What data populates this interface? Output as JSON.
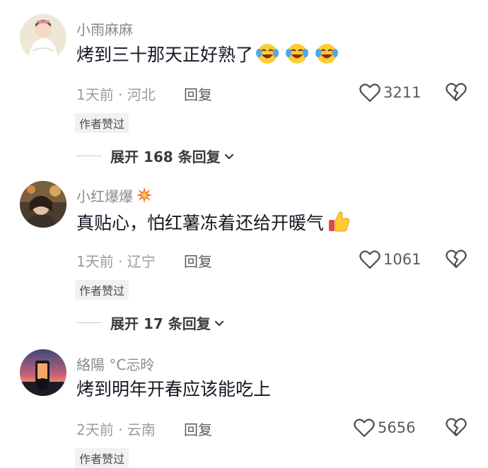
{
  "comments": [
    {
      "username": "小雨麻麻",
      "text": "烤到三十那天正好熟了",
      "text_emoji": [
        "crying-laughing-face",
        "crying-laughing-face",
        "crying-laughing-face"
      ],
      "time_location": "1天前 · 河北",
      "reply_label": "回复",
      "likes": "3211",
      "badge": "作者赞过",
      "expand_label": "展开 168 条回复"
    },
    {
      "username": "小红爆爆",
      "username_emoji": "collision",
      "text": "真贴心，怕红薯冻着还给开暖气",
      "text_emoji": [
        "thumbs-up"
      ],
      "time_location": "1天前 · 辽宁",
      "reply_label": "回复",
      "likes": "1061",
      "badge": "作者赞过",
      "expand_label": "展开 17 条回复"
    },
    {
      "username": "絡陽 °C忈昤",
      "text": "烤到明年开春应该能吃上",
      "time_location": "2天前 · 云南",
      "reply_label": "回复",
      "likes": "5656",
      "badge": "作者赞过"
    }
  ],
  "colors": {
    "text": "#161823",
    "secondary": "#8a8a8f",
    "badge_bg": "#f1f1f3",
    "emoji_yellow": "#ffcc33"
  }
}
